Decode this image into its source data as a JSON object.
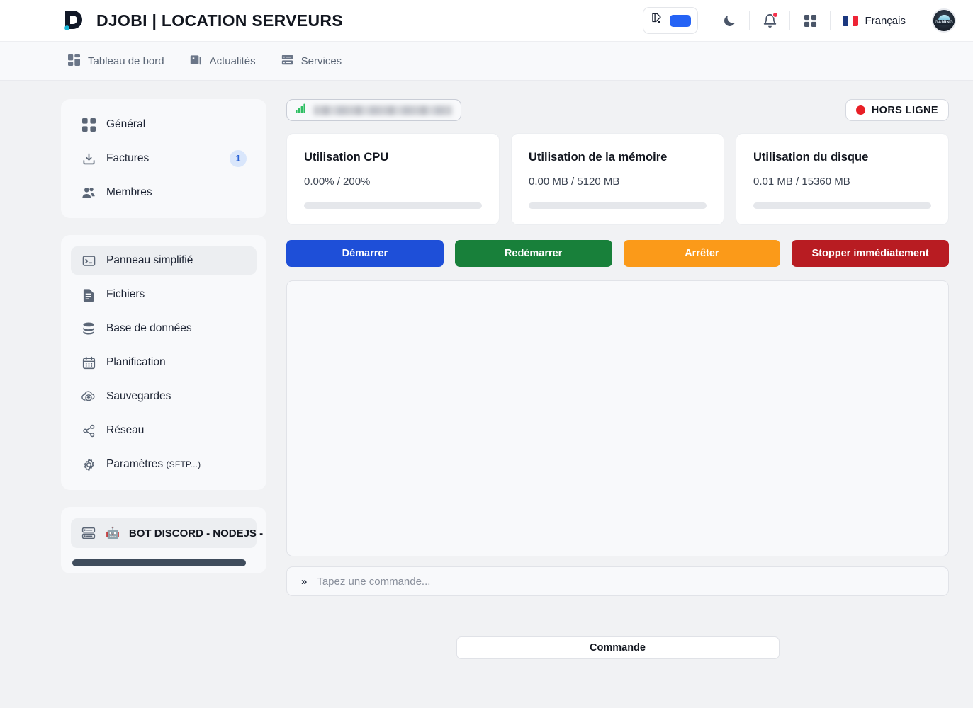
{
  "header": {
    "brand_title": "DJOBI | LOCATION SERVEURS",
    "logo_icon": "djobi-d-logo",
    "theme_icon": "palette-icon",
    "theme_swatch_color": "#2563f5",
    "dark_mode_icon": "moon-icon",
    "notifications_icon": "bell-icon",
    "apps_icon": "grid-apps-icon",
    "language": "Français",
    "flag_icon": "french-flag-icon",
    "avatar_label": "GAMING"
  },
  "nav": {
    "items": [
      {
        "label": "Tableau de bord",
        "icon": "dashboard-icon"
      },
      {
        "label": "Actualités",
        "icon": "news-icon"
      },
      {
        "label": "Services",
        "icon": "server-rack-icon"
      }
    ]
  },
  "sidebar": {
    "group_account": [
      {
        "label": "Général",
        "icon": "grid-icon",
        "badge": null
      },
      {
        "label": "Factures",
        "icon": "invoice-download-icon",
        "badge": "1"
      },
      {
        "label": "Membres",
        "icon": "users-icon",
        "badge": null
      }
    ],
    "group_server": [
      {
        "label": "Panneau simplifié",
        "icon": "terminal-icon",
        "active": true
      },
      {
        "label": "Fichiers",
        "icon": "file-icon",
        "active": false
      },
      {
        "label": "Base de données",
        "icon": "database-icon",
        "active": false
      },
      {
        "label": "Planification",
        "icon": "calendar-icon",
        "active": false
      },
      {
        "label": "Sauvegardes",
        "icon": "cloud-upload-icon",
        "active": false
      },
      {
        "label": "Réseau",
        "icon": "network-icon",
        "active": false
      },
      {
        "label": "Paramètres",
        "label_suffix": "(SFTP...)",
        "icon": "gear-icon",
        "active": false
      }
    ],
    "server_entry": {
      "icon": "server-rack-icon",
      "emoji": "🤖",
      "label": "BOT DISCORD - NODEJS - ST"
    }
  },
  "main": {
    "address_chip": {
      "icon": "signal-bars-icon",
      "value_redacted": true
    },
    "status": {
      "label": "HORS LIGNE",
      "color": "#e81f26"
    },
    "stats": [
      {
        "title": "Utilisation CPU",
        "value": "0.00% / 200%",
        "progress": 0
      },
      {
        "title": "Utilisation de la mémoire",
        "value": "0.00 MB / 5120 MB",
        "progress": 0
      },
      {
        "title": "Utilisation du disque",
        "value": "0.01 MB / 15360 MB",
        "progress": 0
      }
    ],
    "actions": [
      {
        "label": "Démarrer",
        "color": "#1e4fd8"
      },
      {
        "label": "Redémarrer",
        "color": "#18803a"
      },
      {
        "label": "Arrêter",
        "color": "#fb9a19"
      },
      {
        "label": "Stopper immédiatement",
        "color": "#b81c22"
      }
    ],
    "console": {
      "output": ""
    },
    "command_input": {
      "prefix": "»",
      "placeholder": "Tapez une commande...",
      "value": ""
    },
    "command_submit": "Commande"
  }
}
